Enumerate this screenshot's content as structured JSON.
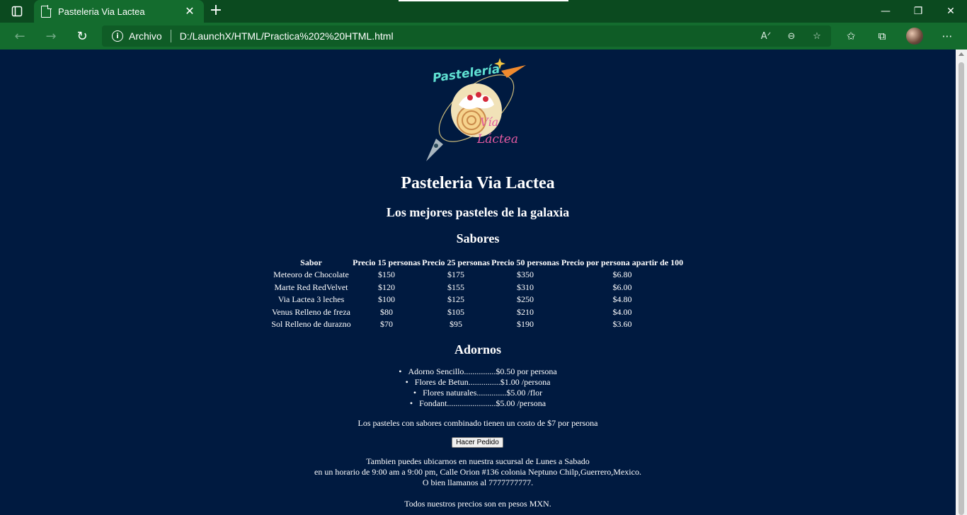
{
  "browser": {
    "tab_title": "Pasteleria Via Lactea",
    "omnibox_label": "Archivo",
    "url": "D:/LaunchX/HTML/Practica%202%20HTML.html"
  },
  "page": {
    "logo_text": "Pastelería Vía Láctea",
    "title": "Pasteleria Via Lactea",
    "subtitle": "Los mejores pasteles de la galaxia",
    "flavors_heading": "Sabores",
    "table": {
      "headers": [
        "Sabor",
        "Precio 15 personas",
        "Precio 25 personas",
        "Precio 50 personas",
        "Precio por persona apartir de 100"
      ],
      "rows": [
        [
          "Meteoro de Chocolate",
          "$150",
          "$175",
          "$350",
          "$6.80"
        ],
        [
          "Marte Red RedVelvet",
          "$120",
          "$155",
          "$310",
          "$6.00"
        ],
        [
          "Via Lactea 3 leches",
          "$100",
          "$125",
          "$250",
          "$4.80"
        ],
        [
          "Venus Relleno de freza",
          "$80",
          "$105",
          "$210",
          "$4.00"
        ],
        [
          "Sol Relleno de durazno",
          "$70",
          "$95",
          "$190",
          "$3.60"
        ]
      ]
    },
    "decorations_heading": "Adornos",
    "decorations": [
      "Adorno Sencillo...............$0.50 por persona",
      "Flores de Betun...............$1.00 /persona",
      "Flores naturales..............$5.00 /flor",
      "Fondant.......................$5.00 /persona"
    ],
    "combined_note": "Los pasteles con sabores combinado tienen un costo de $7 por persona",
    "order_button": "Hacer Pedido",
    "footer": {
      "line1": "Tambien puedes ubicarnos en nuestra sucursal de Lunes a Sabado",
      "line2": "en un horario de 9:00 am a 9:00 pm, Calle Orion #136 colonia Neptuno Chilp,Guerrero,Mexico.",
      "line3": "O bien llamanos al 7777777777.",
      "line4": "Todos nuestros precios son en pesos MXN."
    }
  },
  "colors": {
    "page_background": "#001a40",
    "titlebar": "#0b4a1f",
    "toolbar": "#146c2e"
  }
}
